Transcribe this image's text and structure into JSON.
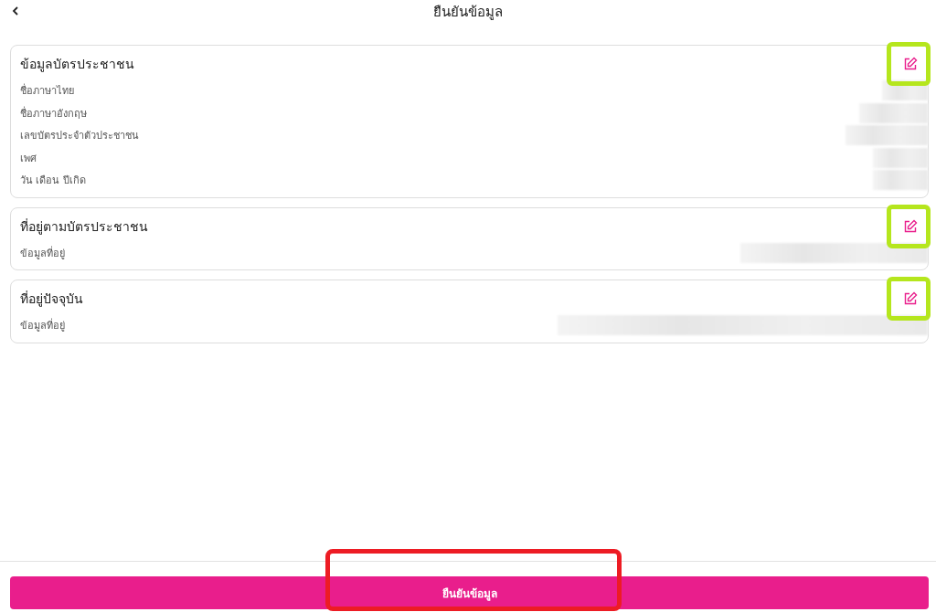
{
  "header": {
    "title": "ยืนยันข้อมูล"
  },
  "sections": [
    {
      "title": "ข้อมูลบัตรประชาชน",
      "highlighted": true,
      "fields": [
        {
          "label": "ชื่อภาษาไทย",
          "redacted": true
        },
        {
          "label": "ชื่อภาษาอังกฤษ",
          "redacted": true
        },
        {
          "label": "เลขบัตรประจำตัวประชาชน",
          "redacted": true
        },
        {
          "label": "เพศ",
          "redacted": true
        },
        {
          "label": "วัน เดือน ปีเกิด",
          "redacted": true
        }
      ]
    },
    {
      "title": "ที่อยู่ตามบัตรประชาชน",
      "highlighted": true,
      "fields": [
        {
          "label": "ข้อมูลที่อยู่",
          "redacted": true
        }
      ]
    },
    {
      "title": "ที่อยู่ปัจจุบัน",
      "highlighted": true,
      "fields": [
        {
          "label": "ข้อมูลที่อยู่",
          "redacted": true
        }
      ]
    }
  ],
  "footer": {
    "button": "ยืนยันข้อมูล",
    "highlighted": true
  }
}
